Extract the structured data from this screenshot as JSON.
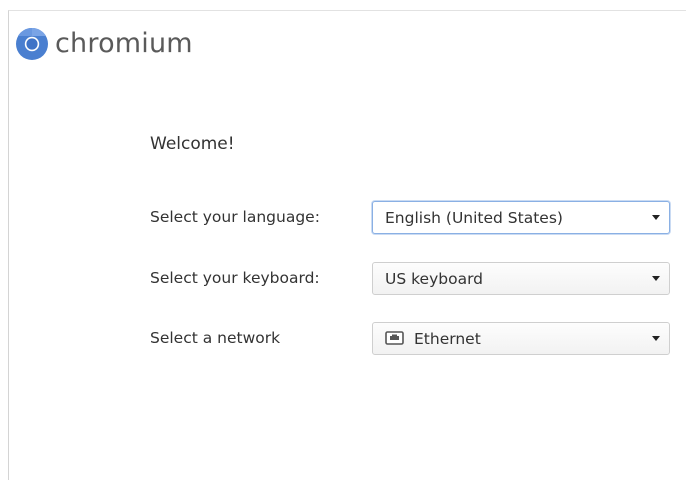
{
  "brand": {
    "name": "chromium",
    "icon": "chromium-logo-icon"
  },
  "welcome": {
    "title": "Welcome!"
  },
  "language": {
    "label": "Select your language:",
    "value": "English (United States)"
  },
  "keyboard": {
    "label": "Select your keyboard:",
    "value": "US keyboard"
  },
  "network": {
    "label": "Select a network",
    "value": "Ethernet",
    "icon": "ethernet-icon"
  },
  "colors": {
    "logo_blue": "#4a7fd0",
    "focus_border": "#8ab0e4",
    "text": "#333333"
  }
}
